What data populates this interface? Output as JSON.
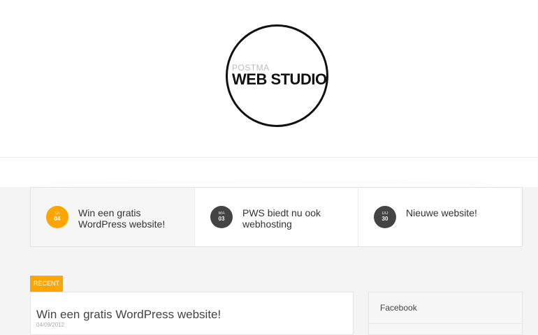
{
  "logo": {
    "top_text": "POSTMA",
    "main_text": "WEB STUDIO"
  },
  "featured": [
    {
      "day": "DI",
      "date": "04",
      "title": "Win een gratis WordPress website!",
      "active": true
    },
    {
      "day": "MA",
      "date": "03",
      "title": "PWS biedt nu ook webhosting",
      "active": false
    },
    {
      "day": "DO",
      "date": "30",
      "title": "Nieuwe website!",
      "active": false
    }
  ],
  "recent": {
    "tag": "RECENT",
    "post_title": "Win een gratis WordPress website!",
    "post_date": "04/09/2012"
  },
  "sidebar": {
    "widget_title": "Facebook"
  },
  "colors": {
    "accent": "#ffa500",
    "badge_dark": "#444444"
  }
}
